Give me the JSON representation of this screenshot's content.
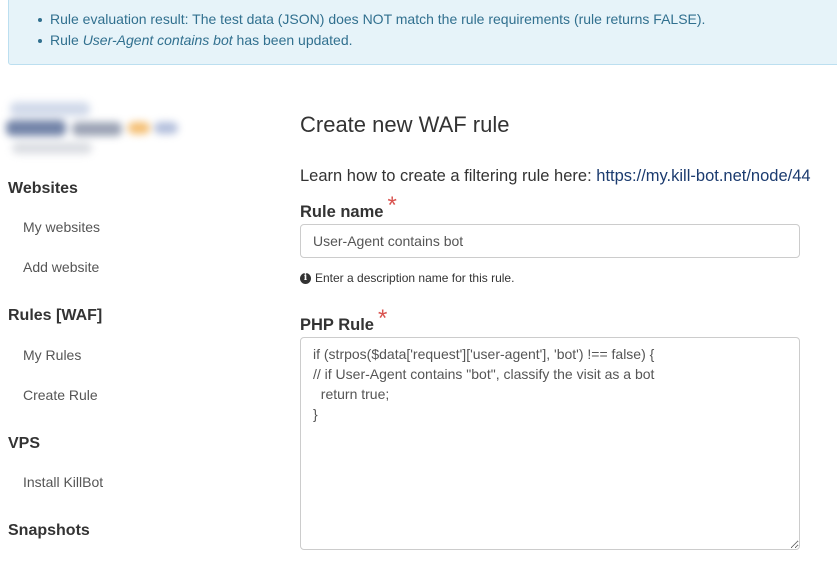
{
  "alert": {
    "line1": "Rule evaluation result: The test data (JSON) does NOT match the rule requirements (rule returns FALSE).",
    "line2_prefix": "Rule ",
    "line2_rule": "User-Agent contains bot",
    "line2_suffix": " has been updated."
  },
  "sidebar": {
    "sections": [
      {
        "title": "Websites",
        "items": [
          "My websites",
          "Add website"
        ]
      },
      {
        "title": "Rules [WAF]",
        "items": [
          "My Rules",
          "Create Rule"
        ]
      },
      {
        "title": "VPS",
        "items": [
          "Install KillBot"
        ]
      },
      {
        "title": "Snapshots",
        "items": []
      }
    ]
  },
  "main": {
    "title": "Create new WAF rule",
    "learn_text": "Learn how to create a filtering rule here: ",
    "learn_link": "https://my.kill-bot.net/node/44",
    "rule_name_label": "Rule name",
    "required_mark": "*",
    "rule_name_value": "User-Agent contains bot",
    "rule_name_help": "Enter a description name for this rule.",
    "php_rule_label": "PHP Rule",
    "php_rule_value": "if (strpos($data['request']['user-agent'], 'bot') !== false) {\n// if User-Agent contains \"bot\", classify the visit as a bot\n  return true;\n}"
  },
  "colors": {
    "alert_bg": "#e6f3f9",
    "alert_text": "#31708f",
    "link": "#1b3b6f",
    "required": "#d9534f"
  }
}
